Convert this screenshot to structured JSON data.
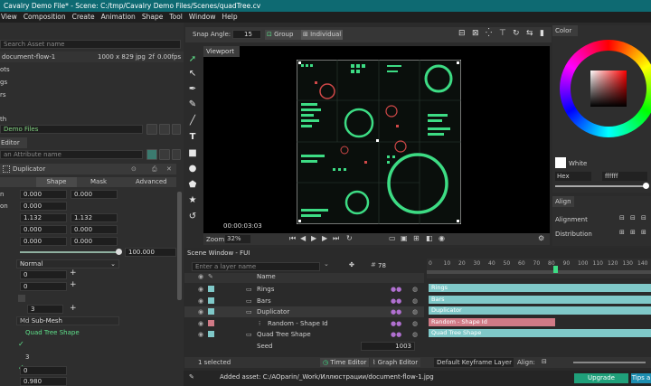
{
  "app": {
    "title": "Cavalry Demo File* - Scene: C:/tmp/Cavalry Demo Files/Scenes/quadTree.cv"
  },
  "menu": [
    "View",
    "Composition",
    "Create",
    "Animation",
    "Shape",
    "Tool",
    "Window",
    "Help"
  ],
  "assets": {
    "search_placeholder": "Search Asset name",
    "file_name": "document-flow-1",
    "file_size": "1000 x 829",
    "file_ext": "jpg",
    "file_fps": "2f",
    "file_fps2": "0.00fps",
    "items": [
      "ots",
      "gs",
      "rs"
    ],
    "path_label": "th",
    "folder": "Demo Files"
  },
  "attr_editor": {
    "title": "Editor",
    "search_placeholder": "an Attribute name",
    "layer_name": "Duplicator",
    "tabs": [
      "Shape",
      "Mask",
      "Advanced"
    ],
    "fields": [
      {
        "label": "n",
        "a": "0.000",
        "b": "0.000"
      },
      {
        "label": "on",
        "a": "0.000",
        "b": ""
      },
      {
        "label": "",
        "a": "1.132",
        "b": "1.132"
      },
      {
        "label": "",
        "a": "0.000",
        "b": "0.000"
      },
      {
        "label": "",
        "a": "0.000",
        "b": "0.000"
      }
    ],
    "opacity_value": "100.000",
    "blend": "Normal",
    "v0": "0",
    "v1": "0",
    "v3": "3",
    "submesh": "Sub-Mesh",
    "submesh_prefix": "Md",
    "quad_tree": "Quad Tree Shape",
    "v3b": "3",
    "v0b": "0",
    "v0980": "0.980"
  },
  "toolbar": {
    "snap_label": "Snap Angle:",
    "snap_value": "15",
    "group_label": "Group",
    "individual_label": "Individual"
  },
  "viewport": {
    "title": "Viewport",
    "timecode": "00:00:03:03",
    "zoom_label": "Zoom",
    "zoom_value": "32%"
  },
  "scene": {
    "title": "Scene Window - FUI",
    "search_placeholder": "Enter a layer name",
    "frame_value": "78",
    "name_header": "Name",
    "layers": [
      {
        "name": "Rings",
        "color": "#7fc8c8",
        "bar": "Rings"
      },
      {
        "name": "Bars",
        "color": "#7fc8c8",
        "bar": "Bars"
      },
      {
        "name": "Duplicator",
        "color": "#7fc8c8",
        "bar": "Duplicator"
      },
      {
        "name": "Random - Shape Id",
        "color": "#d07a86",
        "bar": "Random - Shape Id"
      },
      {
        "name": "Quad Tree Shape",
        "color": "#7fc8c8",
        "bar": "Quad Tree Shape"
      }
    ],
    "seed_label": "Seed",
    "seed_value": "1003",
    "ruler": [
      "0",
      "10",
      "20",
      "30",
      "40",
      "50",
      "60",
      "70",
      "80",
      "90",
      "100",
      "110",
      "120",
      "130",
      "140"
    ],
    "selected_text": "1 selected",
    "time_editor": "Time Editor",
    "graph_editor": "Graph Editor",
    "keyframe_layer": "Default Keyframe Layer",
    "align_label": "Align:"
  },
  "color_panel": {
    "title": "Color",
    "swatch_name": "White",
    "mode": "Hex",
    "hex": "ffffff"
  },
  "align_panel": {
    "title": "Align",
    "alignment": "Alignment",
    "distribution": "Distribution"
  },
  "status": {
    "message": "Added asset: C:/AOparin/_Work/Иллюстрации/document-flow-1.jpg",
    "upgrade": "Upgrade",
    "tips": "Tips a"
  },
  "colors": {
    "accent": "#0e6a72",
    "green": "#3ddc84",
    "teal": "#7fc8c8",
    "pink": "#d07a86"
  }
}
